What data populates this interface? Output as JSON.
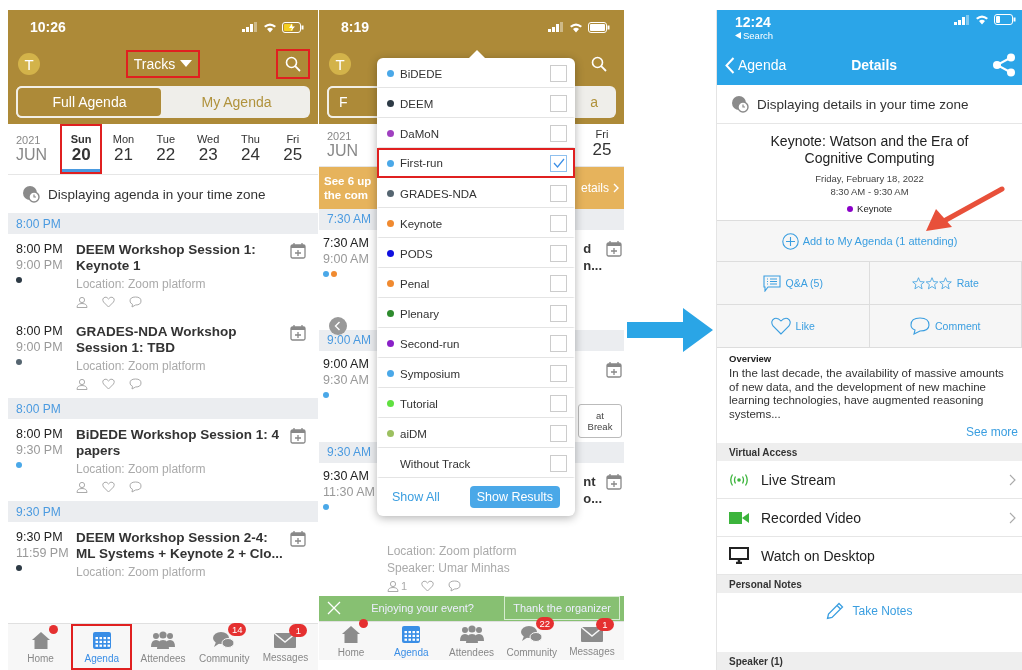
{
  "agenda_screen": {
    "status_bar": {
      "time": "10:26"
    },
    "header": {
      "avatar": "T",
      "tracks_button": {
        "label": "Tracks",
        "highlighted": true
      },
      "search": {
        "highlighted": true
      }
    },
    "segments": [
      {
        "label": "Full Agenda",
        "selected": true
      },
      {
        "label": "My Agenda",
        "selected": false
      }
    ],
    "year": "2021",
    "month": "JUN",
    "days": [
      {
        "weekday": "Sun",
        "date": "20",
        "selected": true,
        "highlighted": true
      },
      {
        "weekday": "Mon",
        "date": "21",
        "selected": false,
        "highlighted": false
      },
      {
        "weekday": "Tue",
        "date": "22",
        "selected": false,
        "highlighted": false
      },
      {
        "weekday": "Wed",
        "date": "23",
        "selected": false,
        "highlighted": false
      },
      {
        "weekday": "Thu",
        "date": "24",
        "selected": false,
        "highlighted": false
      },
      {
        "weekday": "Fri",
        "date": "25",
        "selected": false,
        "highlighted": false
      }
    ],
    "timezone_notice": "Displaying agenda in your time zone",
    "sections": [
      {
        "time": "8:00 PM",
        "events": [
          {
            "start": "8:00 PM",
            "end": "9:00 PM",
            "title": "DEEM Workshop Session 1: Keynote 1",
            "location": "Location: Zoom platform",
            "tracks": [
              {
                "color": "#2d3a45"
              }
            ],
            "actions_visible": true
          },
          {
            "start": "8:00 PM",
            "end": "9:00 PM",
            "title": "GRADES-NDA Workshop Session 1: TBD",
            "location": "Location: Zoom platform",
            "tracks": [
              {
                "color": "#556570"
              }
            ],
            "actions_visible": true
          }
        ]
      },
      {
        "time": "8:00 PM",
        "events": [
          {
            "start": "8:00 PM",
            "end": "9:30 PM",
            "title": "BiDEDE Workshop Session 1: 4 papers",
            "location": "Location: Zoom platform",
            "tracks": [
              {
                "color": "#4aa8e8"
              }
            ],
            "actions_visible": true
          }
        ]
      },
      {
        "time": "9:30 PM",
        "events": [
          {
            "start": "9:30 PM",
            "end": "11:59 PM",
            "title": "DEEM Workshop Session 2-4: ML Systems + Keynote 2 + Clo...",
            "location": "Location: Zoom platform",
            "tracks": [
              {
                "color": "#2d3a45"
              }
            ],
            "actions_visible": false
          }
        ]
      }
    ],
    "tabs": [
      {
        "kind": "home",
        "label": "Home",
        "selected": false,
        "highlighted": false,
        "dot": true
      },
      {
        "kind": "agenda",
        "label": "Agenda",
        "selected": true,
        "highlighted": true
      },
      {
        "kind": "attendees",
        "label": "Attendees",
        "selected": false,
        "highlighted": false
      },
      {
        "kind": "community",
        "label": "Community",
        "selected": false,
        "highlighted": false,
        "count": "14"
      },
      {
        "kind": "messages",
        "label": "Messages",
        "selected": false,
        "highlighted": false,
        "count": "1"
      }
    ]
  },
  "filter_screen": {
    "status_bar": {
      "time": "8:19"
    },
    "header": {
      "avatar": "T"
    },
    "segments": [
      {
        "label": "F",
        "selected": true
      },
      {
        "label": "a",
        "selected": false
      }
    ],
    "year": "2021",
    "month": "JUN",
    "last_day": {
      "weekday": "Fri",
      "date": "25"
    },
    "banner": {
      "lines": [
        "See 6 up",
        "the com"
      ],
      "link": "etails"
    },
    "sections": [
      {
        "time": "7:30 AM",
        "event": {
          "start": "7:30 AM",
          "end": "9:00 AM",
          "tracks": [
            {
              "color": "#4aa8e8"
            },
            {
              "color": "#f08a30"
            }
          ],
          "title_fragments": [
            "d",
            "n..."
          ]
        }
      },
      {
        "time": "9:00 AM",
        "event": {
          "start": "9:00 AM",
          "end": "9:30 AM",
          "tracks": [
            {
              "color": "#4aa8e8"
            }
          ],
          "button": "at Break"
        }
      },
      {
        "time": "9:30 AM",
        "event": {
          "start": "9:30 AM",
          "end": "11:30 AM",
          "tracks": [
            {
              "color": "#4aa8e8"
            }
          ],
          "title_fragments": [
            "nt",
            "o..."
          ],
          "location": "Location: Zoom platform",
          "speaker": "Speaker: Umar Minhas",
          "attendee_count": "1"
        }
      }
    ],
    "track_popover": {
      "tracks": [
        {
          "name": "BiDEDE",
          "color": "#4aa8e8",
          "checked": false,
          "highlighted": false
        },
        {
          "name": "DEEM",
          "color": "#2d3a45",
          "checked": false,
          "highlighted": false
        },
        {
          "name": "DaMoN",
          "color": "#a040c0",
          "checked": false,
          "highlighted": false
        },
        {
          "name": "First-run",
          "color": "#4aa8e8",
          "checked": true,
          "highlighted": true
        },
        {
          "name": "GRADES-NDA",
          "color": "#556570",
          "checked": false,
          "highlighted": false
        },
        {
          "name": "Keynote",
          "color": "#f08a30",
          "checked": false,
          "highlighted": false
        },
        {
          "name": "PODS",
          "color": "#1010e0",
          "checked": false,
          "highlighted": false
        },
        {
          "name": "Penal",
          "color": "#f08a30",
          "checked": false,
          "highlighted": false
        },
        {
          "name": "Plenary",
          "color": "#2e8b2e",
          "checked": false,
          "highlighted": false
        },
        {
          "name": "Second-run",
          "color": "#8a20c8",
          "checked": false,
          "highlighted": false
        },
        {
          "name": "Symposium",
          "color": "#4aa8e8",
          "checked": false,
          "highlighted": false
        },
        {
          "name": "Tutorial",
          "color": "#60e040",
          "checked": false,
          "highlighted": false
        },
        {
          "name": "aiDM",
          "color": "#9cc060",
          "checked": false,
          "highlighted": false
        },
        {
          "name": "Without Track",
          "checked": false,
          "highlighted": false
        }
      ],
      "show_all": "Show All",
      "show_results": "Show Results"
    },
    "feedback": {
      "question": "Enjoying your event?",
      "button": "Thank the organizer"
    },
    "tabs": [
      {
        "kind": "home",
        "label": "Home",
        "selected": false,
        "highlighted": false,
        "dot": true
      },
      {
        "kind": "agenda",
        "label": "Agenda",
        "selected": true,
        "highlighted": false
      },
      {
        "kind": "attendees",
        "label": "Attendees",
        "selected": false,
        "highlighted": false
      },
      {
        "kind": "community",
        "label": "Community",
        "selected": false,
        "highlighted": false,
        "count": "22"
      },
      {
        "kind": "messages",
        "label": "Messages",
        "selected": false,
        "highlighted": false,
        "count": "1"
      }
    ]
  },
  "details_screen": {
    "status_bar": {
      "time": "12:24",
      "back_app": "Search"
    },
    "nav": {
      "back": "Agenda",
      "title": "Details"
    },
    "timezone_notice": "Displaying details in your time zone",
    "session": {
      "title": "Keynote: Watson and the Era of Cognitive Computing",
      "date": "Friday, February 18, 2022",
      "time": "8:30 AM - 9:30 AM",
      "track": {
        "name": "Keynote",
        "color": "#8a00c8"
      }
    },
    "add_button": "Add to My Agenda (1 attending)",
    "actions": [
      {
        "kind": "qa",
        "label": "Q&A (5)"
      },
      {
        "kind": "rate",
        "label": "Rate"
      },
      {
        "kind": "like",
        "label": "Like"
      },
      {
        "kind": "comment",
        "label": "Comment"
      }
    ],
    "overview": {
      "heading": "Overview",
      "text": "In the last decade, the availability of massive amounts of new data, and the development of new machine learning technologies, have augmented reasoning systems...",
      "more": "See more"
    },
    "virtual_access": {
      "heading": "Virtual Access",
      "items": [
        {
          "kind": "live",
          "label": "Live Stream",
          "chevron": true
        },
        {
          "kind": "video",
          "label": "Recorded Video",
          "chevron": true
        },
        {
          "kind": "desktop",
          "label": "Watch on Desktop",
          "chevron": false
        }
      ]
    },
    "personal_notes": {
      "heading": "Personal Notes",
      "action": "Take Notes"
    },
    "speaker_heading": "Speaker (1)"
  }
}
